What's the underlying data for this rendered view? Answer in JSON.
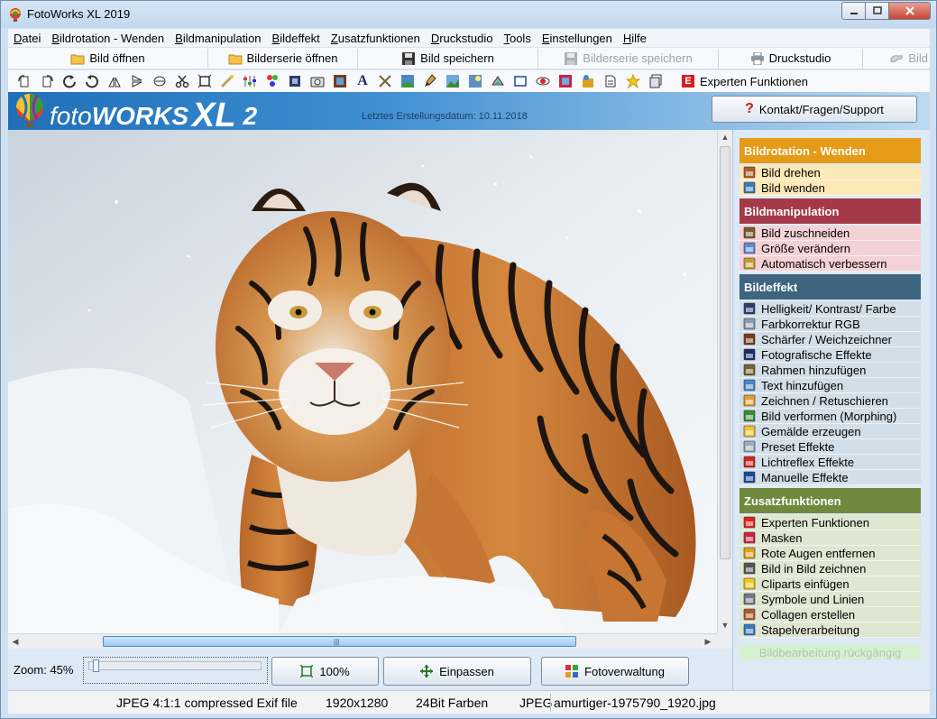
{
  "window": {
    "title": "FotoWorks XL 2019"
  },
  "menubar": [
    {
      "label": "Datei",
      "u": "D",
      "rest": "atei"
    },
    {
      "label": "Bildrotation - Wenden",
      "u": "B",
      "rest": "ildrotation - Wenden"
    },
    {
      "label": "Bildmanipulation",
      "u": "B",
      "rest": "ildmanipulation"
    },
    {
      "label": "Bildeffekt",
      "u": "B",
      "rest": "ildeffekt"
    },
    {
      "label": "Zusatzfunktionen",
      "u": "Z",
      "rest": "usatzfunktionen"
    },
    {
      "label": "Druckstudio",
      "u": "D",
      "rest": "ruckstudio"
    },
    {
      "label": "Tools",
      "u": "T",
      "rest": "ools"
    },
    {
      "label": "Einstellungen",
      "u": "E",
      "rest": "instellungen"
    },
    {
      "label": "Hilfe",
      "u": "H",
      "rest": "ilfe"
    }
  ],
  "toolbar": {
    "open_image": "Bild öffnen",
    "open_series": "Bilderserie öffnen",
    "save_image": "Bild speichern",
    "save_series": "Bilderserie speichern",
    "print_studio": "Druckstudio",
    "bild_partial": "Bild"
  },
  "iconbar": {
    "expert_label": "Experten Funktionen",
    "expert_badge": "E",
    "text_glyph": "A"
  },
  "banner": {
    "brand_foto": "foto",
    "brand_works": "WORKS",
    "brand_xl": "XL",
    "brand_version": "2",
    "build_date": "Letztes Erstellungsdatum: 10.11.2018",
    "support_label": "Kontakt/Fragen/Support",
    "support_glyph": "?"
  },
  "zoom": {
    "label": "Zoom: 45%",
    "level_percent": 45,
    "btn_100": "100%",
    "btn_fit": "Einpassen",
    "btn_manager": "Fotoverwaltung"
  },
  "side_panel": {
    "groups": [
      {
        "title": "Bildrotation - Wenden",
        "color": "#e59b17",
        "item_bg": "#fde9b8",
        "items": [
          "Bild drehen",
          "Bild wenden"
        ]
      },
      {
        "title": "Bildmanipulation",
        "color": "#a43a48",
        "item_bg": "#f3d2d6",
        "items": [
          "Bild zuschneiden",
          "Größe verändern",
          "Automatisch verbessern"
        ]
      },
      {
        "title": "Bildeffekt",
        "color": "#3e6580",
        "item_bg": "#d3dfe8",
        "items": [
          "Helligkeit/ Kontrast/ Farbe",
          "Farbkorrektur RGB",
          "Schärfer / Weichzeichner",
          "Fotografische Effekte",
          "Rahmen hinzufügen",
          "Text hinzufügen",
          "Zeichnen / Retuschieren",
          "Bild verformen (Morphing)",
          "Gemälde erzeugen",
          "Preset Effekte",
          "Lichtreflex Effekte",
          "Manuelle Effekte"
        ]
      },
      {
        "title": "Zusatzfunktionen",
        "color": "#6f8a3f",
        "item_bg": "#dfe6d2",
        "items": [
          "Experten Funktionen",
          "Masken",
          "Rote Augen entfernen",
          "Bild in Bild zeichnen",
          "Cliparts einfügen",
          "Symbole und Linien",
          "Collagen erstellen",
          "Stapelverarbeitung"
        ]
      }
    ],
    "undo_label": "Bildbearbeitung rückgängig"
  },
  "statusbar": {
    "format": "JPEG 4:1:1 compressed Exif file",
    "dimensions": "1920x1280",
    "color_depth": "24Bit Farben",
    "type": "JPEG",
    "filename": "amurtiger-1975790_1920.jpg"
  },
  "colors": {
    "banner_blue": "#2a7cc4",
    "accent_red": "#d71f1f"
  }
}
